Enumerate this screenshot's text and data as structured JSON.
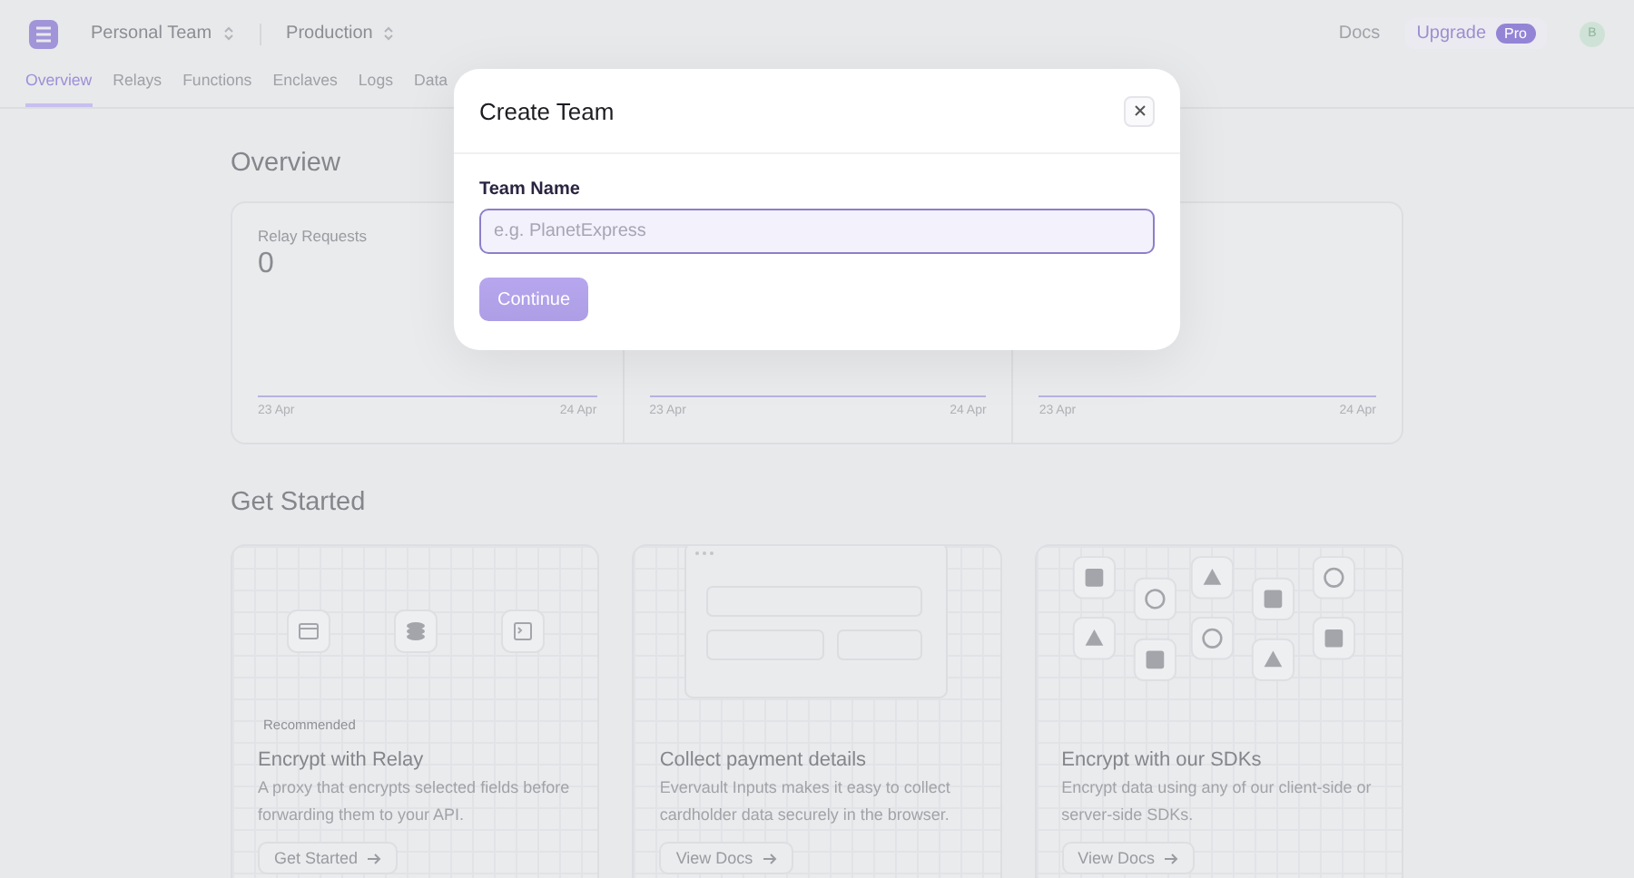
{
  "header": {
    "team": "Personal Team",
    "environment": "Production",
    "docs": "Docs",
    "upgrade": {
      "label": "Upgrade",
      "badge": "Pro"
    },
    "avatar": "B"
  },
  "tabs": [
    {
      "label": "Overview",
      "selected": true
    },
    {
      "label": "Relays",
      "selected": false
    },
    {
      "label": "Functions",
      "selected": false
    },
    {
      "label": "Enclaves",
      "selected": false
    },
    {
      "label": "Logs",
      "selected": false
    },
    {
      "label": "Data",
      "selected": false
    }
  ],
  "overview": {
    "heading": "Overview",
    "stats": [
      {
        "label": "Relay Requests",
        "value": "0",
        "start": "23 Apr",
        "end": "24 Apr"
      },
      {
        "start": "23 Apr",
        "end": "24 Apr"
      },
      {
        "start": "23 Apr",
        "end": "24 Apr"
      }
    ]
  },
  "get_started": {
    "heading": "Get Started",
    "cards": [
      {
        "kind": "relay",
        "badge": "Recommended",
        "title": "Encrypt with Relay",
        "description": "A proxy that encrypts selected fields before forwarding them to your API.",
        "button": "Get Started"
      },
      {
        "kind": "payment",
        "title": "Collect payment details",
        "description": "Evervault Inputs makes it easy to collect cardholder data securely in the browser.",
        "button": "View Docs"
      },
      {
        "kind": "sdks",
        "title": "Encrypt with our SDKs",
        "description": "Encrypt data using any of our client-side or server-side SDKs.",
        "button": "View Docs"
      }
    ]
  },
  "modal": {
    "title": "Create Team",
    "field": {
      "label": "Team Name",
      "placeholder": "e.g. PlanetExpress"
    },
    "button": {
      "label": "Continue",
      "disabled": true
    }
  }
}
